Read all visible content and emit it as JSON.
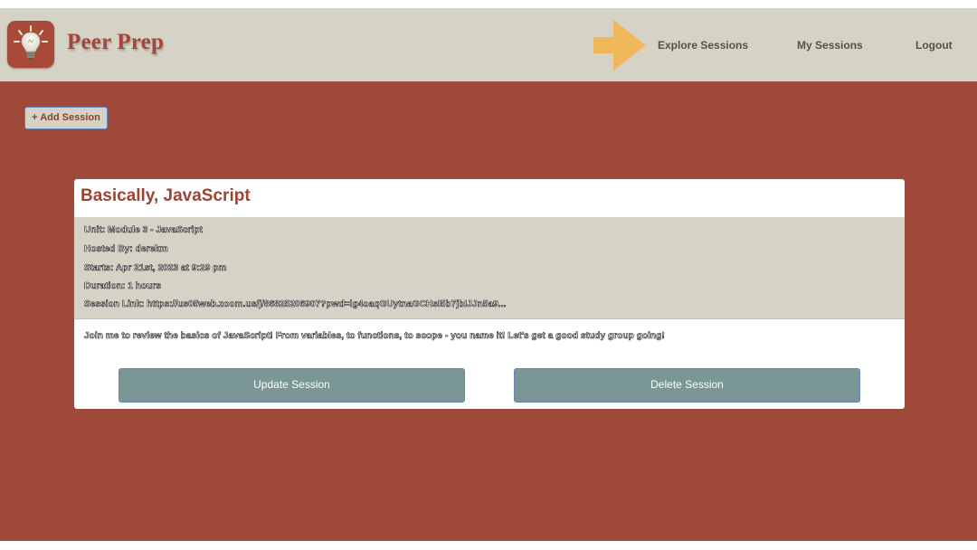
{
  "header": {
    "brand": "Peer Prep",
    "logo_icon": "lightbulb-icon",
    "indicator_icon": "arrow-right-icon",
    "nav": {
      "explore": "Explore Sessions",
      "my_sessions": "My Sessions",
      "logout": "Logout"
    }
  },
  "toolbar": {
    "add_session_label": "+ Add Session"
  },
  "session": {
    "title": "Basically, JavaScript",
    "unit": "Unit: Module 3 - JavaScript",
    "host": "Hosted By: derekm",
    "starts": "Starts: Apr 21st, 2023 at 9:29 pm",
    "duration": "Duration: 1 hours",
    "link": "Session Link: https://us05web.zoom.us/j/86825206907?pwd=lg4oaqGUytnaGCHsI5b7jbIJJn5a9...",
    "description": "Join me to review the basics of JavaScript! From variables, to functions, to scope - you name it! Let's get a good study group going!",
    "update_label": "Update Session",
    "delete_label": "Delete Session"
  },
  "colors": {
    "navbar_bg": "#d6d3c6",
    "main_bg": "#9e4939",
    "brand": "#a6463a",
    "button_bg": "#7a9695",
    "arrow": "#f0b85a"
  }
}
